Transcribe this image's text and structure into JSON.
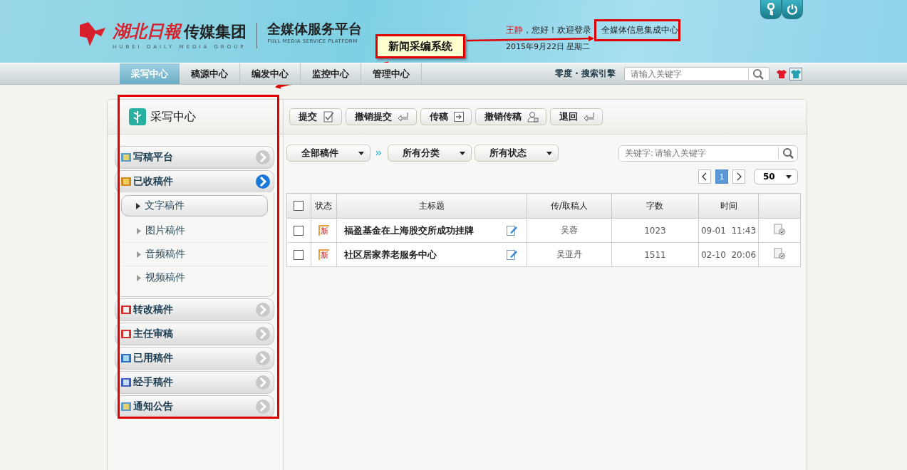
{
  "header": {
    "logo_cn": "湖北日報",
    "logo_group": "传媒集团",
    "logo_en": "HUBEI DAILY MEDIA GROUP",
    "platform": "全媒体服务平台",
    "platform_en": "FULL MEDIA SERVICE PLATFORM",
    "user": "王静",
    "welcome": "，您好！欢迎登录",
    "site_name": "全媒体信息集成中心",
    "date": "2015年9月22日  星期二"
  },
  "nav": {
    "tabs": [
      {
        "label": "采写中心",
        "selected": true
      },
      {
        "label": "稿源中心",
        "selected": false
      },
      {
        "label": "编发中心",
        "selected": false
      },
      {
        "label": "监控中心",
        "selected": false
      },
      {
        "label": "管理中心",
        "selected": false
      }
    ],
    "search_label": "零度 · 搜索引擎",
    "search_placeholder": "请输入关键字",
    "skins": [
      {
        "color": "#e01828",
        "selected": false
      },
      {
        "color": "#28a0b4",
        "selected": true
      }
    ]
  },
  "sidebar": {
    "title": "采写中心",
    "items": [
      {
        "label": "写稿平台",
        "expanded": false
      },
      {
        "label": "已收稿件",
        "expanded": true,
        "children": [
          {
            "label": "文字稿件",
            "selected": true
          },
          {
            "label": "图片稿件",
            "selected": false
          },
          {
            "label": "音频稿件",
            "selected": false
          },
          {
            "label": "视频稿件",
            "selected": false
          }
        ]
      },
      {
        "label": "转改稿件",
        "expanded": false
      },
      {
        "label": "主任审稿",
        "expanded": false
      },
      {
        "label": "已用稿件",
        "expanded": false
      },
      {
        "label": "经手稿件",
        "expanded": false
      },
      {
        "label": "通知公告",
        "expanded": false
      }
    ]
  },
  "toolbar": [
    "提交",
    "撤销提交",
    "传稿",
    "撤销传稿",
    "退回"
  ],
  "filters": [
    "全部稿件",
    "所有分类",
    "所有状态"
  ],
  "search": {
    "label": "关键字:",
    "placeholder": "请输入关键字"
  },
  "pagination": {
    "pages": [
      {
        "label": "1",
        "selected": true
      }
    ],
    "page_size": "50"
  },
  "table": {
    "select_all": false,
    "columns": [
      {
        "kind": "checkbox"
      },
      {
        "kind": "text",
        "label": "状态"
      },
      {
        "kind": "text",
        "label": "主标题"
      },
      {
        "kind": "text",
        "label": "传/取稿人"
      },
      {
        "kind": "text",
        "label": "字数"
      },
      {
        "kind": "text",
        "label": "时间"
      },
      {
        "kind": "blank"
      }
    ],
    "rows": [
      {
        "checked": false,
        "status": "新",
        "title": "福盈基金在上海股交所成功挂牌",
        "author": "吴蓉",
        "words": "1023",
        "time": "09-01  11:43"
      },
      {
        "checked": false,
        "status": "新",
        "title": "社区居家养老服务中心",
        "author": "吴亚丹",
        "words": "1511",
        "time": "02-10  20:06"
      }
    ]
  },
  "annotation": {
    "callout": "新闻采编系统"
  }
}
